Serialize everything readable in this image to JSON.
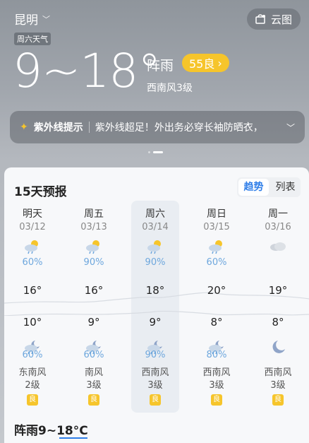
{
  "header": {
    "city": "昆明",
    "cloud_map_label": "云图",
    "day_tag": "周六天气"
  },
  "current": {
    "temp_range": "9~18°",
    "condition": "阵雨",
    "aqi": "55良",
    "wind": "西南风3级"
  },
  "uv": {
    "title": "紫外线提示",
    "message": "紫外线超足！外出务必穿长袖防晒衣，"
  },
  "forecast": {
    "title": "15天预报",
    "view_trend": "趋势",
    "view_list": "列表",
    "days": [
      {
        "name": "明天",
        "date": "03/12",
        "day_icon": "sun-cloud-rain-icon",
        "day_precip": "60%",
        "high": "16°",
        "low": "10°",
        "night_icon": "moon-cloud-rain-icon",
        "night_precip": "60%",
        "wind_dir": "东南风",
        "wind_level": "2级",
        "aqi": "良"
      },
      {
        "name": "周五",
        "date": "03/13",
        "day_icon": "sun-cloud-rain-icon",
        "day_precip": "90%",
        "high": "16°",
        "low": "9°",
        "night_icon": "moon-cloud-rain-icon",
        "night_precip": "60%",
        "wind_dir": "南风",
        "wind_level": "3级",
        "aqi": "良"
      },
      {
        "name": "周六",
        "date": "03/14",
        "day_icon": "sun-cloud-rain-icon",
        "day_precip": "90%",
        "high": "18°",
        "low": "9°",
        "night_icon": "moon-cloud-rain-icon",
        "night_precip": "90%",
        "wind_dir": "西南风",
        "wind_level": "3级",
        "aqi": "良"
      },
      {
        "name": "周日",
        "date": "03/15",
        "day_icon": "sun-cloud-rain-icon",
        "day_precip": "60%",
        "high": "20°",
        "low": "8°",
        "night_icon": "moon-cloud-rain-icon",
        "night_precip": "80%",
        "wind_dir": "西南风",
        "wind_level": "3级",
        "aqi": "良"
      },
      {
        "name": "周一",
        "date": "03/16",
        "day_icon": "cloudy-icon",
        "day_precip": "",
        "high": "19°",
        "low": "8°",
        "night_icon": "moon-icon",
        "night_precip": "",
        "wind_dir": "西南风",
        "wind_level": "3级",
        "aqi": "良"
      }
    ],
    "summary": "阵雨9~18°C"
  },
  "colors": {
    "accent": "#2f7ee8",
    "aqi_good": "#f6c52b",
    "precip": "#6ea7dd"
  }
}
